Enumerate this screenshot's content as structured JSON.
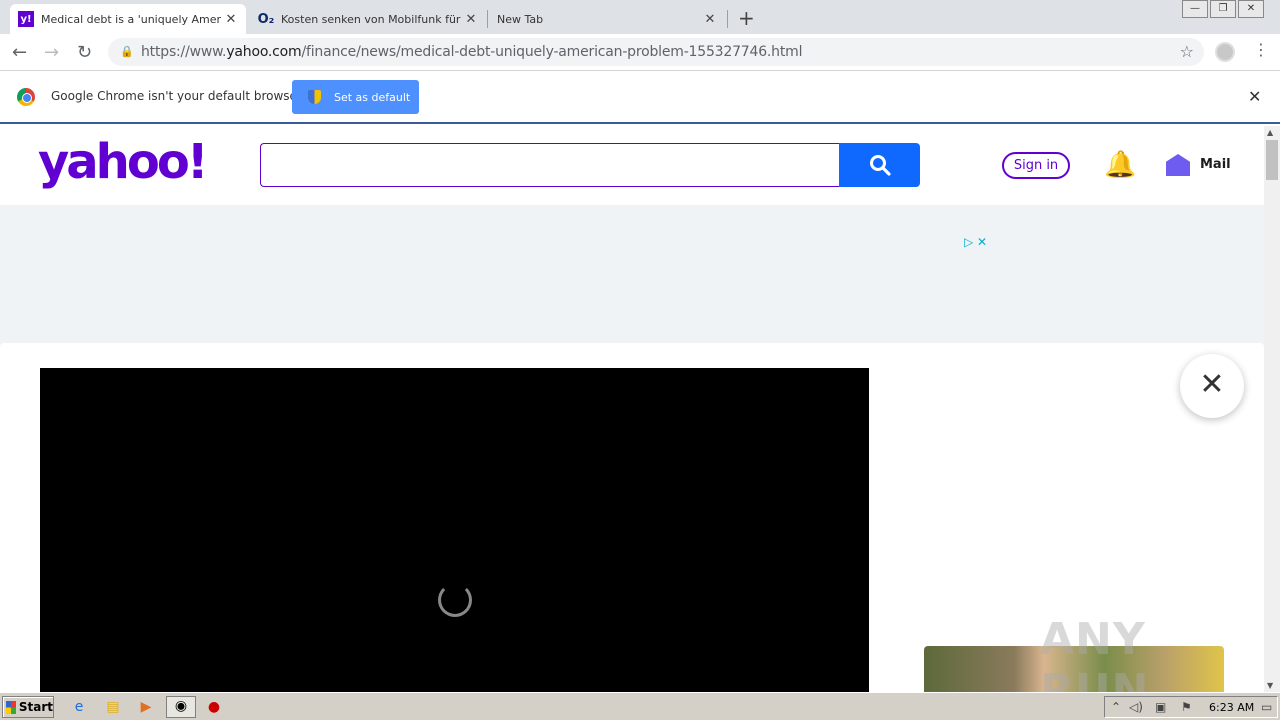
{
  "tabs": [
    {
      "title": "Medical debt is a 'uniquely American",
      "favicon": "yahoo-favicon",
      "active": true
    },
    {
      "title": "Kosten senken von Mobilfunk für Ge",
      "favicon": "o2-favicon",
      "active": false
    },
    {
      "title": "New Tab",
      "favicon": "",
      "active": false
    }
  ],
  "omnibox": {
    "url_prefix": "https://www.",
    "url_domain": "yahoo.com",
    "url_path": "/finance/news/medical-debt-uniquely-american-problem-155327746.html"
  },
  "infobar": {
    "message": "Google Chrome isn't your default browser",
    "button_label": "Set as default"
  },
  "yahoo": {
    "logo_text": "yahoo!",
    "search_placeholder": "",
    "signin_label": "Sign in",
    "mail_label": "Mail"
  },
  "taskbar": {
    "start_label": "Start",
    "clock": "6:23 AM"
  },
  "watermark": "ANY RUN",
  "colors": {
    "yahoo_purple": "#6001d2",
    "search_blue": "#0f69ff",
    "bell_yellow": "#ffb700",
    "infobar_button": "#4d90fe"
  }
}
